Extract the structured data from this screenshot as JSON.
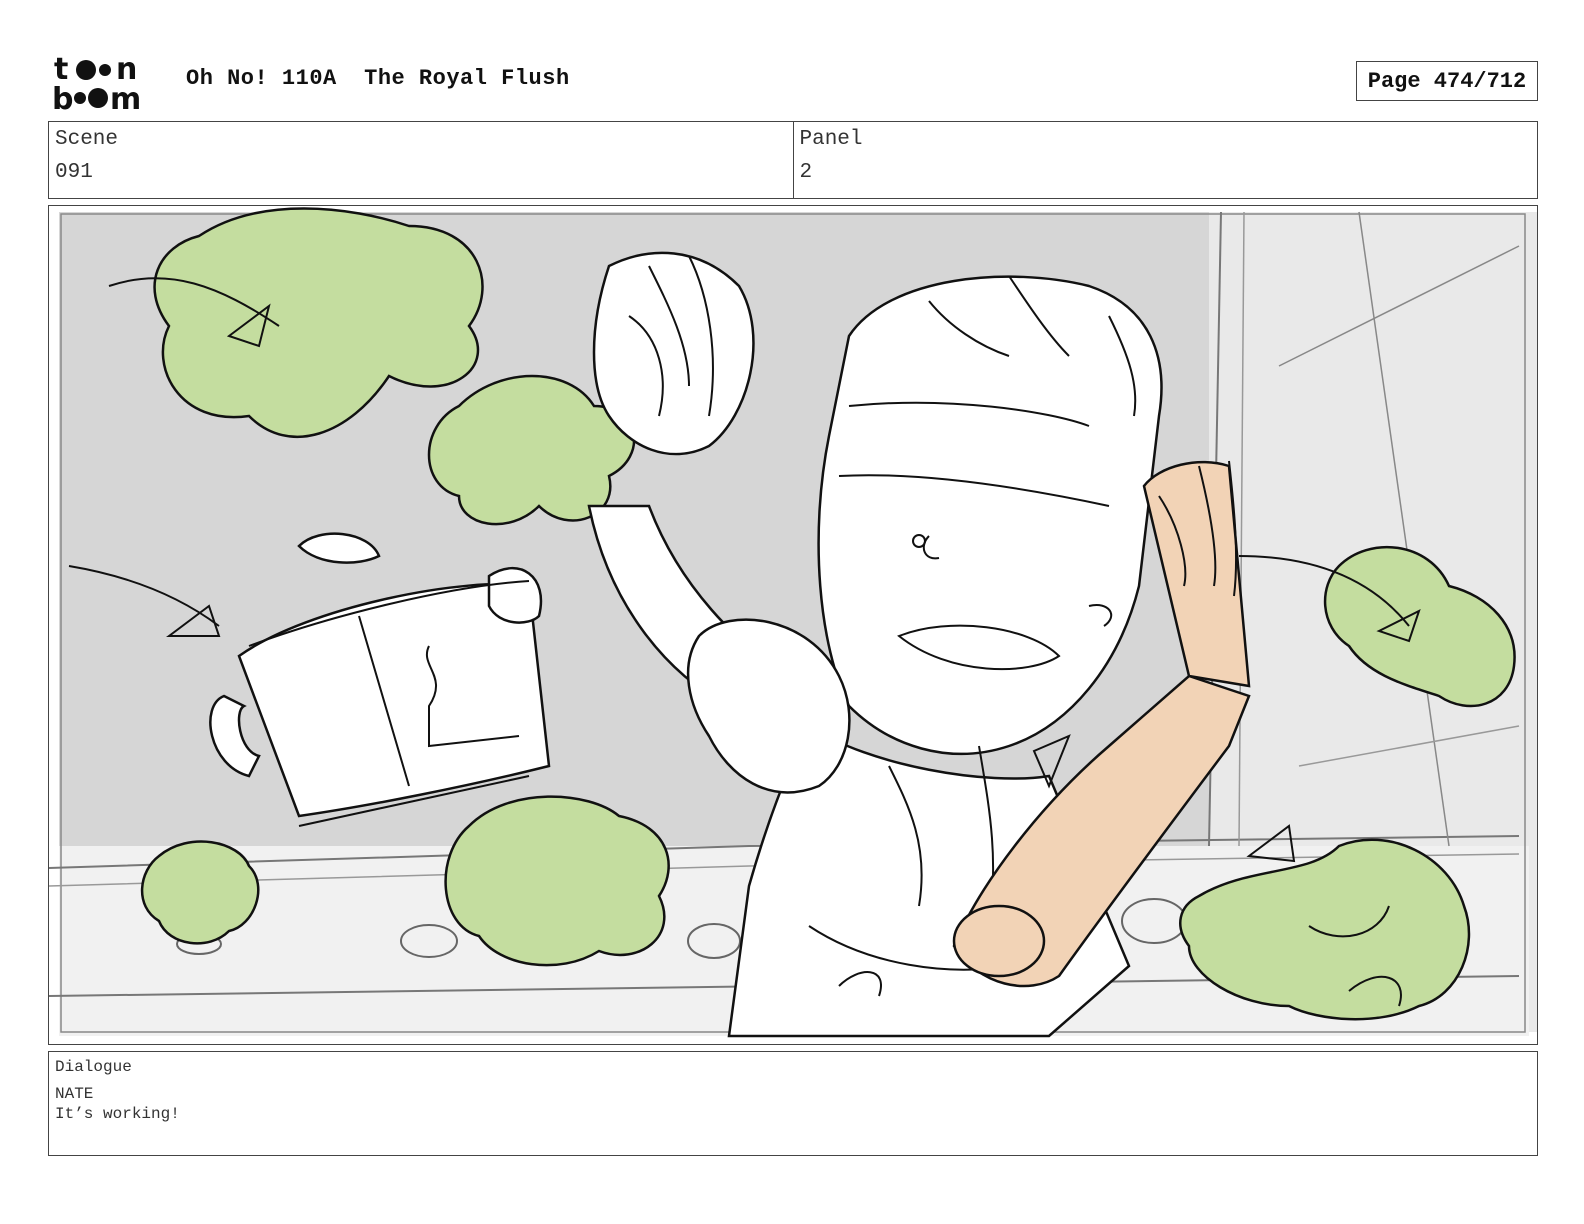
{
  "header": {
    "logo_text": "toon boom",
    "title": "Oh No! 110A  The Royal Flush",
    "page": "Page 474/712"
  },
  "info": {
    "scene_label": "Scene",
    "scene_value": "091",
    "panel_label": "Panel",
    "panel_value": "2"
  },
  "dialogue": {
    "label": "Dialogue",
    "speaker": "NATE",
    "line": "It’s working!"
  },
  "colors": {
    "border": "#444444",
    "sketch_bg": "#d6d6d6",
    "leaf_green": "#c4dd9f",
    "arm_skin": "#f2d3b6",
    "wall_light": "#e9e9e9"
  }
}
